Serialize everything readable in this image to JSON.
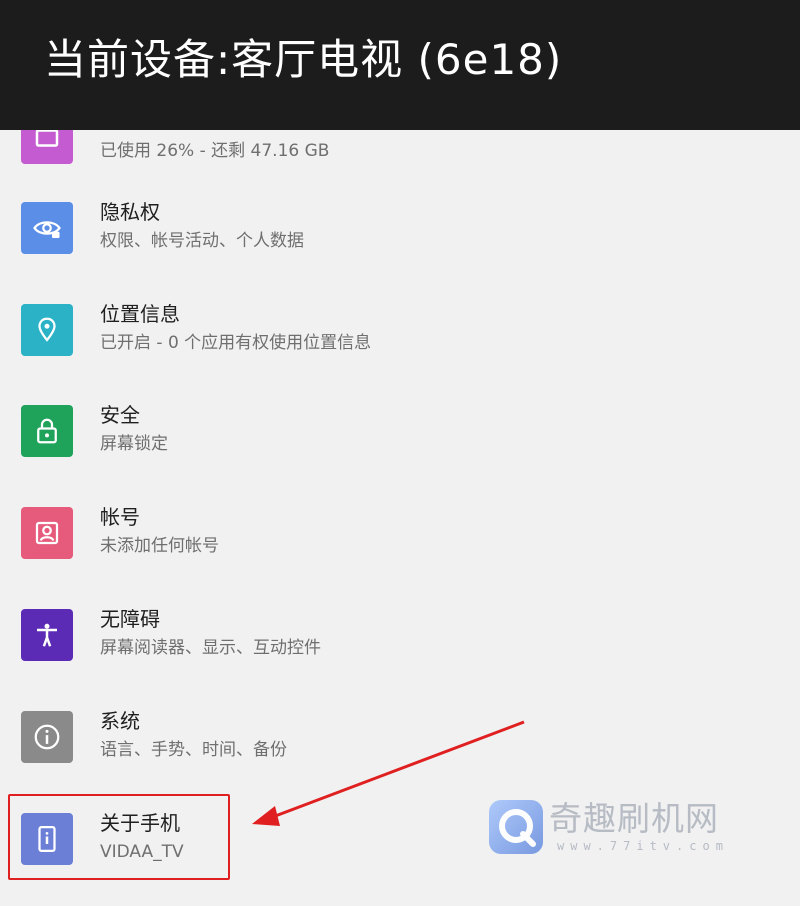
{
  "header": {
    "title": "当前设备:客厅电视 (6e18)"
  },
  "settings": {
    "items": [
      {
        "title": "",
        "subtitle": "已使用 26% - 还剩 47.16 GB",
        "icon": "storage-icon",
        "color": "#c45bd1"
      },
      {
        "title": "隐私权",
        "subtitle": "权限、帐号活动、个人数据",
        "icon": "privacy-eye-icon",
        "color": "#5b8ee6"
      },
      {
        "title": "位置信息",
        "subtitle": "已开启 - 0 个应用有权使用位置信息",
        "icon": "location-pin-icon",
        "color": "#2bb2c7"
      },
      {
        "title": "安全",
        "subtitle": "屏幕锁定",
        "icon": "lock-icon",
        "color": "#1fa35a"
      },
      {
        "title": "帐号",
        "subtitle": "未添加任何帐号",
        "icon": "account-icon",
        "color": "#e65b7c"
      },
      {
        "title": "无障碍",
        "subtitle": "屏幕阅读器、显示、互动控件",
        "icon": "accessibility-icon",
        "color": "#5b2bb5"
      },
      {
        "title": "系统",
        "subtitle": "语言、手势、时间、备份",
        "icon": "info-icon",
        "color": "#8a8a8a"
      },
      {
        "title": "关于手机",
        "subtitle": "VIDAA_TV",
        "icon": "phone-icon",
        "color": "#6b7fd6"
      }
    ]
  },
  "watermark": {
    "text": "奇趣刷机网",
    "url": "www.77itv.com"
  },
  "annotation": {
    "color": "#e02020"
  }
}
